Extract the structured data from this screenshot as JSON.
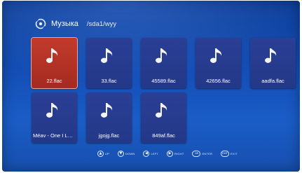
{
  "header": {
    "title": "Музыка",
    "path": "/sda1/wyy",
    "icon": "music-app-icon"
  },
  "files": [
    {
      "name": "22.flac",
      "selected": true
    },
    {
      "name": "33.flac",
      "selected": false
    },
    {
      "name": "45589.flac",
      "selected": false
    },
    {
      "name": "42656.flac",
      "selected": false
    },
    {
      "name": "aadfa.flac",
      "selected": false
    },
    {
      "name": "Méav - One I Lov...",
      "selected": false
    },
    {
      "name": "jgojg.flac",
      "selected": false
    },
    {
      "name": "849af.flac",
      "selected": false
    }
  ],
  "hints": [
    {
      "key": "▲",
      "label": "UP"
    },
    {
      "key": "▼",
      "label": "DOWN"
    },
    {
      "key": "◀",
      "label": "LEFT"
    },
    {
      "key": "▶",
      "label": "RIGHT"
    },
    {
      "key": "OK",
      "label": "ENTER"
    },
    {
      "key": "EXIT",
      "label": "EXIT"
    }
  ],
  "colors": {
    "background": "#1550b8",
    "tile": "#2a3f95",
    "selected_tile": "#c33a2c"
  }
}
